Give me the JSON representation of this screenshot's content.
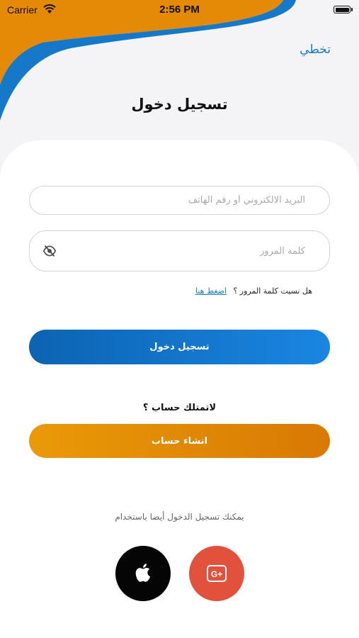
{
  "status_bar": {
    "carrier": "Carrier",
    "time": "2:56 PM"
  },
  "header": {
    "skip_label": "تخطي",
    "title": "تسجيل دخول"
  },
  "form": {
    "email_placeholder": "البريد الالكتروني أو رقم الهاتف",
    "password_placeholder": "كلمة المرور",
    "forgot_text": "هل نسيت كلمة المرور ؟",
    "forgot_link": "اضغط هنا",
    "login_label": "تسجيل دخول",
    "no_account_text": "لاتمتلك حساب ؟",
    "register_label": "انشاء حساب"
  },
  "social": {
    "text": "يمكنك تسجيل الدخول أيضا باستخدام",
    "apple_icon": "apple-icon",
    "google_icon": "google-plus-icon"
  },
  "colors": {
    "orange": "#e48a06",
    "blue": "#1678c8",
    "google_red": "#e2513b",
    "background": "#f4f4f6"
  }
}
